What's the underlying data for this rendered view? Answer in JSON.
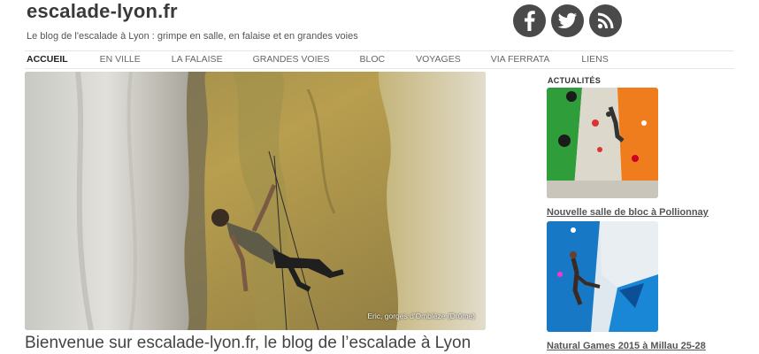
{
  "site": {
    "title": "escalade-lyon.fr",
    "tagline": "Le blog de l'escalade à Lyon : grimpe en salle, en falaise et en grandes voies"
  },
  "social": [
    {
      "name": "facebook",
      "icon": "facebook-icon"
    },
    {
      "name": "twitter",
      "icon": "twitter-icon"
    },
    {
      "name": "rss",
      "icon": "rss-icon"
    }
  ],
  "nav": {
    "items": [
      "ACCUEIL",
      "EN VILLE",
      "LA FALAISE",
      "GRANDES VOIES",
      "BLOC",
      "VOYAGES",
      "VIA FERRATA",
      "LIENS"
    ],
    "active": "ACCUEIL"
  },
  "hero": {
    "caption": "Eric, gorges d'Omblèze (Drôme)"
  },
  "main": {
    "heading": "Bienvenue sur escalade-lyon.fr, le blog de l’escalade à Lyon"
  },
  "sidebar": {
    "heading": "ACTUALITÉS",
    "posts": [
      {
        "title": "Nouvelle salle de bloc à Pollionnay"
      },
      {
        "title": "Natural Games 2015 à Millau 25-28"
      }
    ]
  },
  "colors": {
    "social_bg": "#4a4a4a",
    "nav_text": "#666666",
    "nav_active": "#222222",
    "link": "#555555"
  }
}
